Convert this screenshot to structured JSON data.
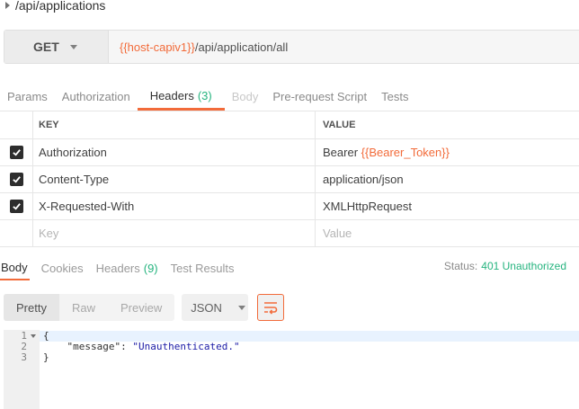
{
  "breadcrumb": {
    "label": "/api/applications"
  },
  "request": {
    "method": "GET",
    "url_var": "{{host-capiv1}}",
    "url_path": "/api/application/all"
  },
  "request_tabs": [
    {
      "label": "Params"
    },
    {
      "label": "Authorization"
    },
    {
      "label": "Headers",
      "count": "(3)"
    },
    {
      "label": "Body"
    },
    {
      "label": "Pre-request Script"
    },
    {
      "label": "Tests"
    }
  ],
  "headers_table": {
    "col_key": "KEY",
    "col_value": "VALUE",
    "rows": [
      {
        "key": "Authorization",
        "value_prefix": "Bearer ",
        "value_var": "{{Bearer_Token}}",
        "checked": true
      },
      {
        "key": "Content-Type",
        "value": "application/json",
        "checked": true
      },
      {
        "key": "X-Requested-With",
        "value": "XMLHttpRequest",
        "checked": true
      }
    ],
    "placeholder_key": "Key",
    "placeholder_value": "Value"
  },
  "response_tabs": [
    {
      "label": "Body"
    },
    {
      "label": "Cookies"
    },
    {
      "label": "Headers",
      "count": "(9)"
    },
    {
      "label": "Test Results"
    }
  ],
  "status": {
    "label": "Status:",
    "code": "401 Unauthorized"
  },
  "view": {
    "modes": [
      "Pretty",
      "Raw",
      "Preview"
    ],
    "format": "JSON",
    "wrap_icon": "wrap-lines-icon"
  },
  "editor": {
    "lines": [
      "1",
      "2",
      "3"
    ],
    "open": "{",
    "key": "\"message\"",
    "sep": ": ",
    "value": "\"Unauthenticated.\"",
    "close": "}"
  },
  "colors": {
    "accent": "#f26b3a",
    "success": "#26b47f"
  }
}
